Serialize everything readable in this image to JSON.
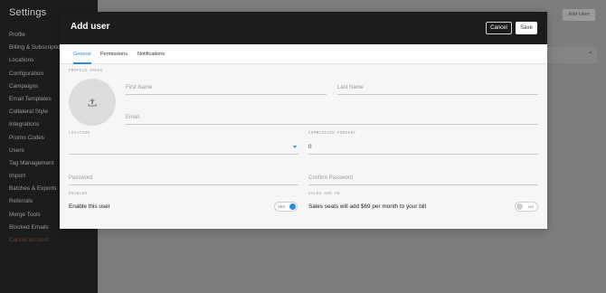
{
  "sidebar": {
    "title": "Settings",
    "items": [
      {
        "label": "Profile"
      },
      {
        "label": "Billing & Subscription"
      },
      {
        "label": "Locations"
      },
      {
        "label": "Configuration"
      },
      {
        "label": "Campaigns"
      },
      {
        "label": "Email Templates"
      },
      {
        "label": "Collateral Style"
      },
      {
        "label": "Integrations"
      },
      {
        "label": "Promo Codes"
      },
      {
        "label": "Users"
      },
      {
        "label": "Tag Management"
      },
      {
        "label": "Import"
      },
      {
        "label": "Batches & Exports"
      },
      {
        "label": "Referrals"
      },
      {
        "label": "Merge Tools"
      },
      {
        "label": "Blocked Emails"
      },
      {
        "label": "Cancel account"
      }
    ]
  },
  "background": {
    "add_user_button": "Add User"
  },
  "modal": {
    "title": "Add user",
    "cancel_label": "Cancel",
    "save_label": "Save",
    "tabs": [
      {
        "label": "General",
        "active": true
      },
      {
        "label": "Permissions",
        "active": false
      },
      {
        "label": "Notifications",
        "active": false
      }
    ],
    "profile_image_caption": "PROFILE IMAGE",
    "first_name_placeholder": "First Name",
    "last_name_placeholder": "Last Name",
    "email_placeholder": "Email",
    "location_caption": "LOCATION",
    "location_value": "",
    "commission_caption": "COMMISSION PERCENT",
    "commission_value": "0",
    "password_placeholder": "Password",
    "confirm_password_placeholder": "Confirm Password",
    "enabled_caption": "ENABLED",
    "enabled_label": "Enable this user",
    "enabled_toggle_text": "YES",
    "enabled_state": true,
    "sales_caption": "SALES ADD ON",
    "sales_label": "Sales seats will add $69 per month to your bill",
    "sales_toggle_text": "NO",
    "sales_state": false
  },
  "colors": {
    "accent": "#2a8fd6",
    "header_bg": "#1c1c1c",
    "overlay": "#7a7a7a"
  }
}
